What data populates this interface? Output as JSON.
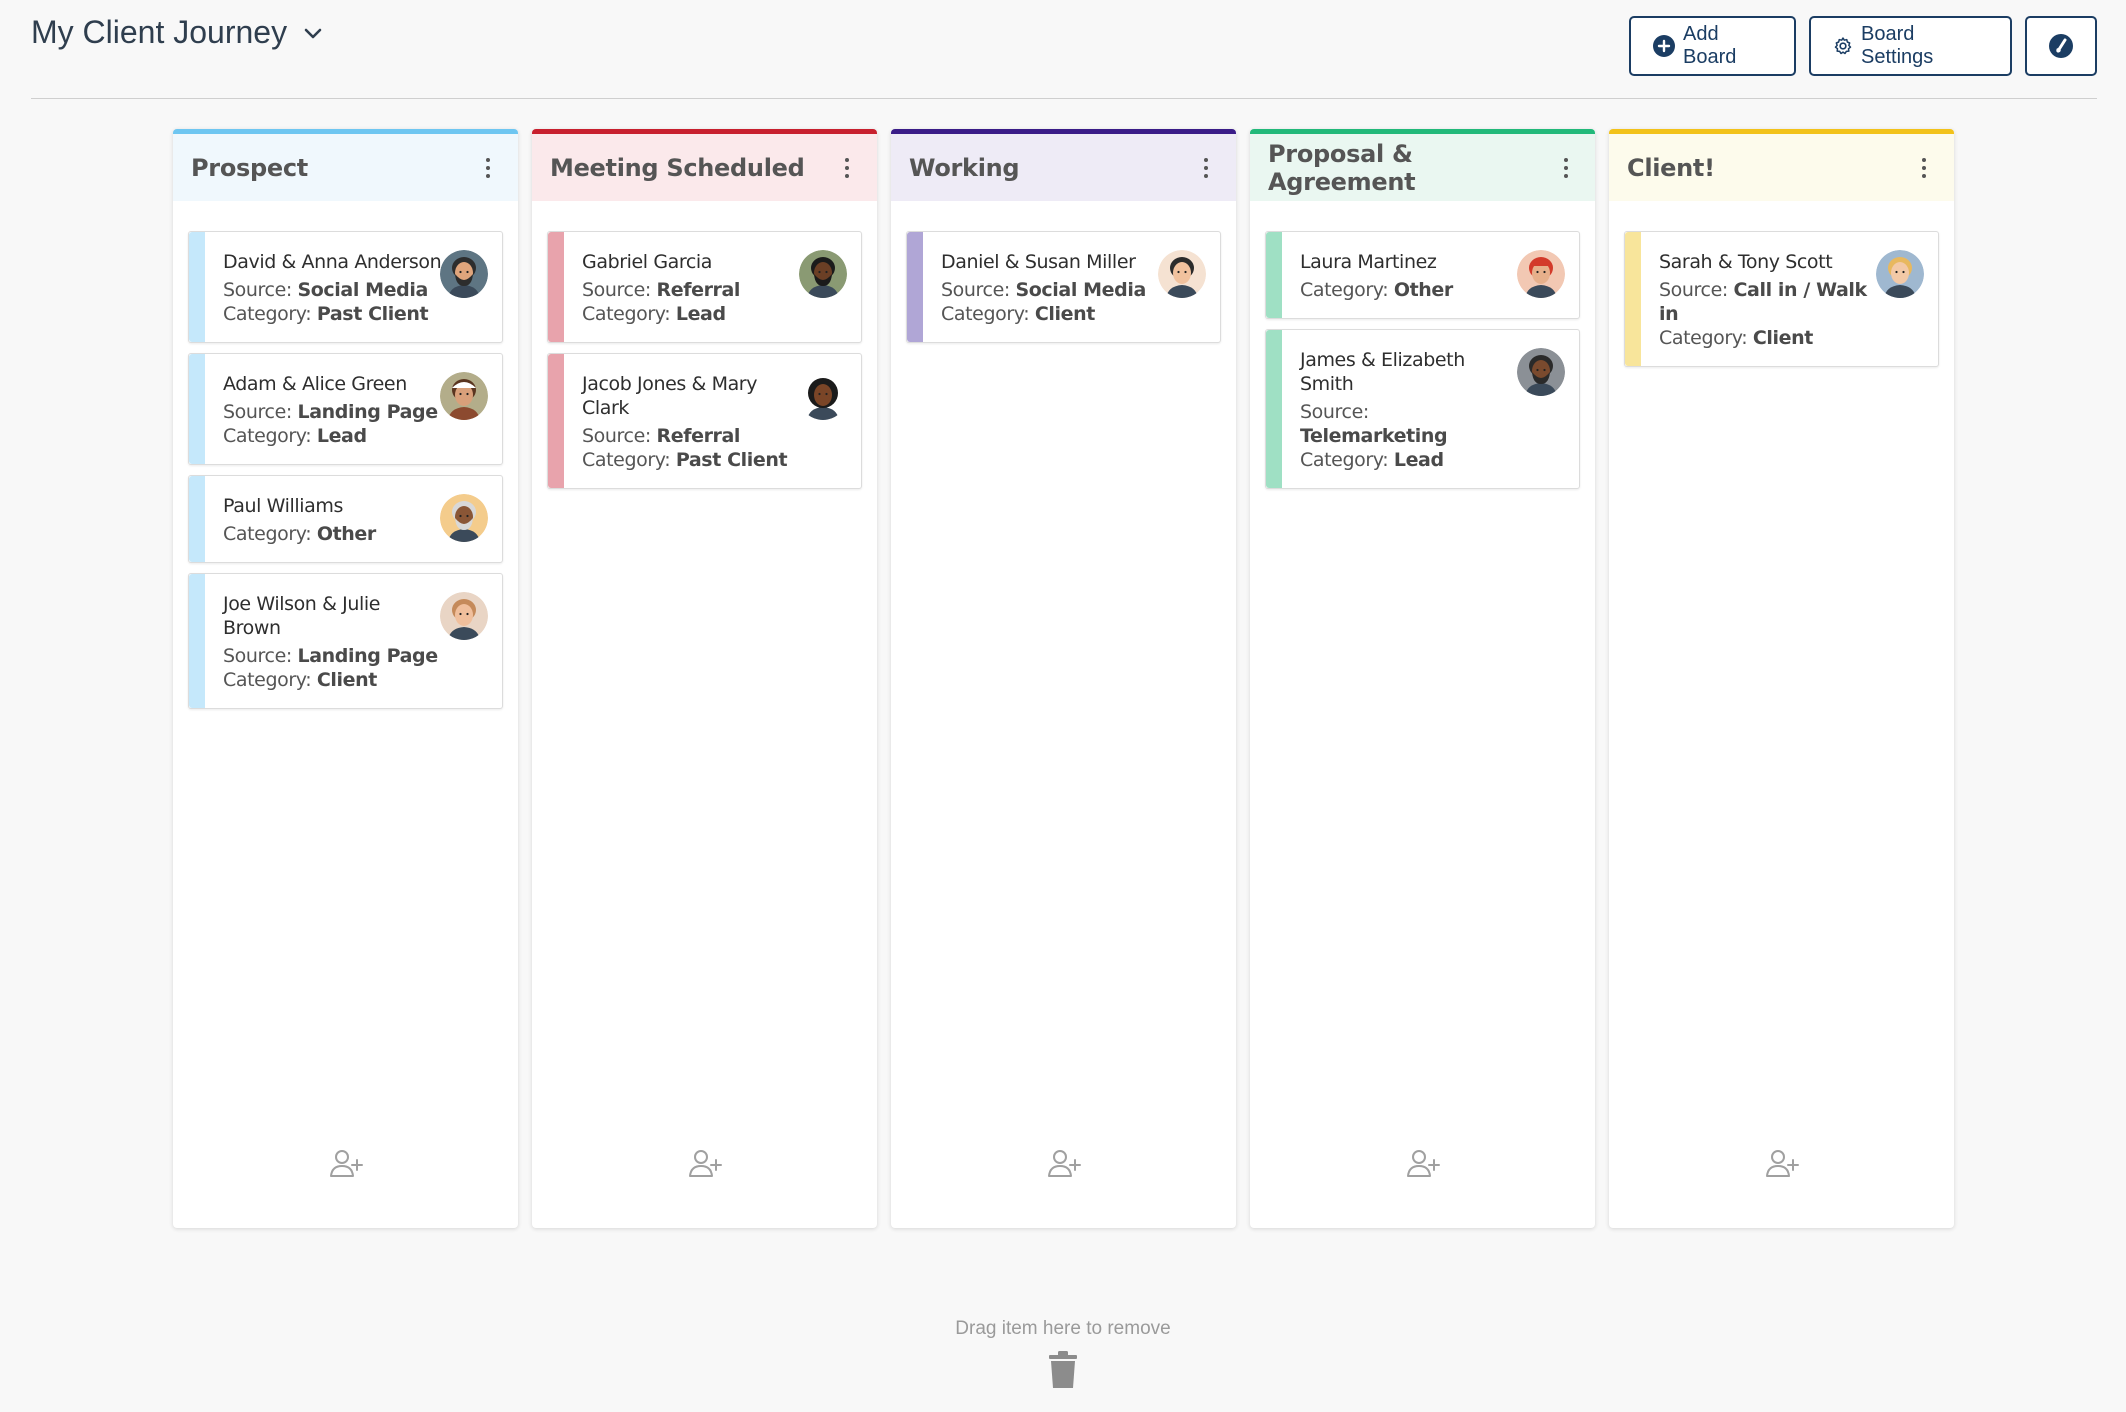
{
  "header": {
    "title": "My Client Journey",
    "add_board": "Add Board",
    "board_settings": "Board Settings"
  },
  "columns": [
    {
      "title": "Prospect",
      "color": "#6ec6f1",
      "head_bg": "#f0f8fd",
      "stripe": "#c5e8fb",
      "cards": [
        {
          "name": "David & Anna Anderson",
          "source_label": "Source:",
          "source": "Social Media",
          "category_label": "Category:",
          "category": "Past Client",
          "avatar": "man-beard-gray"
        },
        {
          "name": "Adam & Alice Green",
          "source_label": "Source:",
          "source": "Landing Page",
          "category_label": "Category:",
          "category": "Lead",
          "avatar": "woman-hat"
        },
        {
          "name": "Paul Williams",
          "category_label": "Category:",
          "category": "Other",
          "avatar": "man-old"
        },
        {
          "name": "Joe Wilson & Julie Brown",
          "source_label": "Source:",
          "source": "Landing Page",
          "category_label": "Category:",
          "category": "Client",
          "avatar": "woman-blonde"
        }
      ]
    },
    {
      "title": "Meeting Scheduled",
      "color": "#c8202e",
      "head_bg": "#fbe9eb",
      "stripe": "#e8a3ac",
      "cards": [
        {
          "name": "Gabriel Garcia",
          "source_label": "Source:",
          "source": "Referral",
          "category_label": "Category:",
          "category": "Lead",
          "avatar": "man-dark"
        },
        {
          "name": "Jacob Jones & Mary Clark",
          "source_label": "Source:",
          "source": "Referral",
          "category_label": "Category:",
          "category": "Past Client",
          "avatar": "woman-curly"
        }
      ]
    },
    {
      "title": "Working",
      "color": "#3a1c88",
      "head_bg": "#eeebf6",
      "stripe": "#b0a6d6",
      "cards": [
        {
          "name": "Daniel & Susan Miller",
          "source_label": "Source:",
          "source": "Social Media",
          "category_label": "Category:",
          "category": "Client",
          "avatar": "man-young"
        }
      ]
    },
    {
      "title": "Proposal & Agreement",
      "color": "#22b97a",
      "head_bg": "#eaf7f1",
      "stripe": "#9fe0c4",
      "cards": [
        {
          "name": "Laura Martinez",
          "category_label": "Category:",
          "category": "Other",
          "avatar": "woman-red"
        },
        {
          "name": "James & Elizabeth Smith",
          "source_label": "Source:",
          "source": "Telemarketing",
          "category_label": "Category:",
          "category": "Lead",
          "avatar": "man-gray-bg"
        }
      ]
    },
    {
      "title": "Client!",
      "color": "#f2c21a",
      "head_bg": "#fdfbec",
      "stripe": "#f8e59b",
      "cards": [
        {
          "name": "Sarah & Tony Scott",
          "source_label": "Source:",
          "source": "Call in / Walk in",
          "category_label": "Category:",
          "category": "Client",
          "avatar": "woman-blonde-blue"
        }
      ]
    }
  ],
  "footer": {
    "drag_text": "Drag item here to remove"
  }
}
